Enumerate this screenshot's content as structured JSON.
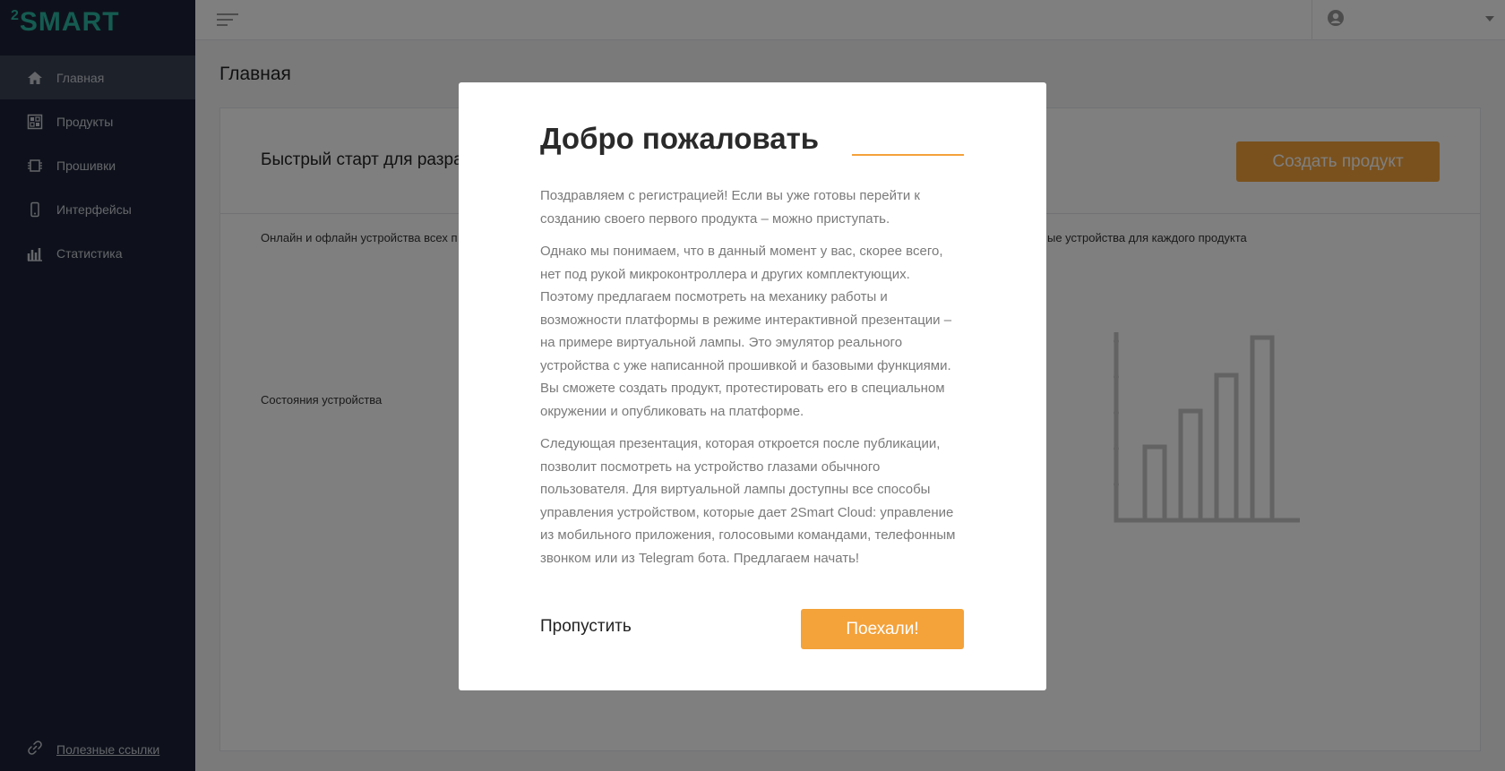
{
  "app": {
    "logo_prefix": "2",
    "logo_text": "SMART"
  },
  "sidebar": {
    "items": [
      {
        "label": "Главная",
        "icon": "home-icon"
      },
      {
        "label": "Продукты",
        "icon": "products-icon"
      },
      {
        "label": "Прошивки",
        "icon": "firmware-icon"
      },
      {
        "label": "Интерфейсы",
        "icon": "phone-icon"
      },
      {
        "label": "Статистика",
        "icon": "stats-icon"
      }
    ],
    "footer_link": "Полезные ссылки"
  },
  "main": {
    "page_title": "Главная",
    "quick_start": "Быстрый старт для разра",
    "create_product": "Создать продукт",
    "online_devices": "Онлайн и офлайн устройства всех п",
    "per_product": "ые устройства для каждого продукта",
    "device_states": "Состояния устройства"
  },
  "modal": {
    "title": "Добро пожаловать",
    "paragraphs": [
      "Поздравляем с регистрацией! Если вы уже готовы перейти к созданию своего первого продукта – можно приступать.",
      "Однако мы понимаем, что в данный момент у вас, скорее всего, нет под рукой микроконтроллера и других комплектующих. Поэтому предлагаем посмотреть на механику работы и возможности платформы в режиме интерактивной презентации – на примере виртуальной лампы. Это эмулятор реального устройства с уже написанной прошивкой и базовыми функциями. Вы сможете создать продукт, протестировать его в специальном окружении и опубликовать на платформе.",
      "Следующая презентация, которая откроется после публикации, позволит посмотреть на устройство глазами обычного пользователя. Для виртуальной лампы доступны все способы управления устройством, которые дает 2Smart Cloud: управление из мобильного приложения, голосовыми командами, телефонным звонком или из Telegram бота. Предлагаем начать!"
    ],
    "skip": "Пропустить",
    "go": "Поехали!"
  },
  "colors": {
    "accent": "#f4a23a",
    "sidebar_bg": "#1c2337",
    "logo": "#2bb6a3"
  }
}
